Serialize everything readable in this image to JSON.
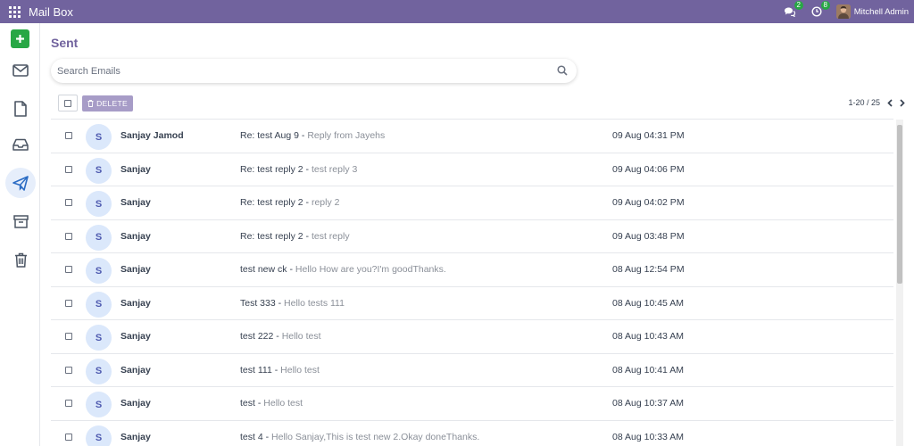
{
  "topbar": {
    "app_title": "Mail Box",
    "chat_badge": "2",
    "activity_badge": "8",
    "user_name": "Mitchell Admin"
  },
  "sidebar": {
    "items": [
      "compose",
      "inbox",
      "drafts",
      "all-mail",
      "sent",
      "archive",
      "trash"
    ],
    "active": "sent"
  },
  "main": {
    "title": "Sent",
    "search_placeholder": "Search Emails",
    "delete_label": "DELETE",
    "pager": "1-20 / 25"
  },
  "emails": [
    {
      "initial": "S",
      "sender": "Sanjay Jamod",
      "subject": "Re: test Aug 9",
      "preview": "Reply from Jayehs",
      "date": "09 Aug 04:31 PM"
    },
    {
      "initial": "S",
      "sender": "Sanjay",
      "subject": "Re: test reply 2",
      "preview": "test reply 3",
      "date": "09 Aug 04:06 PM"
    },
    {
      "initial": "S",
      "sender": "Sanjay",
      "subject": "Re: test reply 2",
      "preview": "reply 2",
      "date": "09 Aug 04:02 PM"
    },
    {
      "initial": "S",
      "sender": "Sanjay",
      "subject": "Re: test reply 2",
      "preview": "test reply",
      "date": "09 Aug 03:48 PM"
    },
    {
      "initial": "S",
      "sender": "Sanjay",
      "subject": "test new ck",
      "preview": "Hello How are you?I'm goodThanks.",
      "date": "08 Aug 12:54 PM"
    },
    {
      "initial": "S",
      "sender": "Sanjay",
      "subject": "Test 333",
      "preview": "Hello tests 111",
      "date": "08 Aug 10:45 AM"
    },
    {
      "initial": "S",
      "sender": "Sanjay",
      "subject": "test 222",
      "preview": "Hello test",
      "date": "08 Aug 10:43 AM"
    },
    {
      "initial": "S",
      "sender": "Sanjay",
      "subject": "test 111",
      "preview": "Hello test",
      "date": "08 Aug 10:41 AM"
    },
    {
      "initial": "S",
      "sender": "Sanjay",
      "subject": "test",
      "preview": "Hello test",
      "date": "08 Aug 10:37 AM"
    },
    {
      "initial": "S",
      "sender": "Sanjay",
      "subject": "test 4",
      "preview": "Hello Sanjay,This is test new 2.Okay doneThanks.",
      "date": "08 Aug 10:33 AM"
    }
  ],
  "colors": {
    "topbar": "#71639e",
    "compose": "#28a745",
    "avatar_bg": "#dbe8fb"
  }
}
